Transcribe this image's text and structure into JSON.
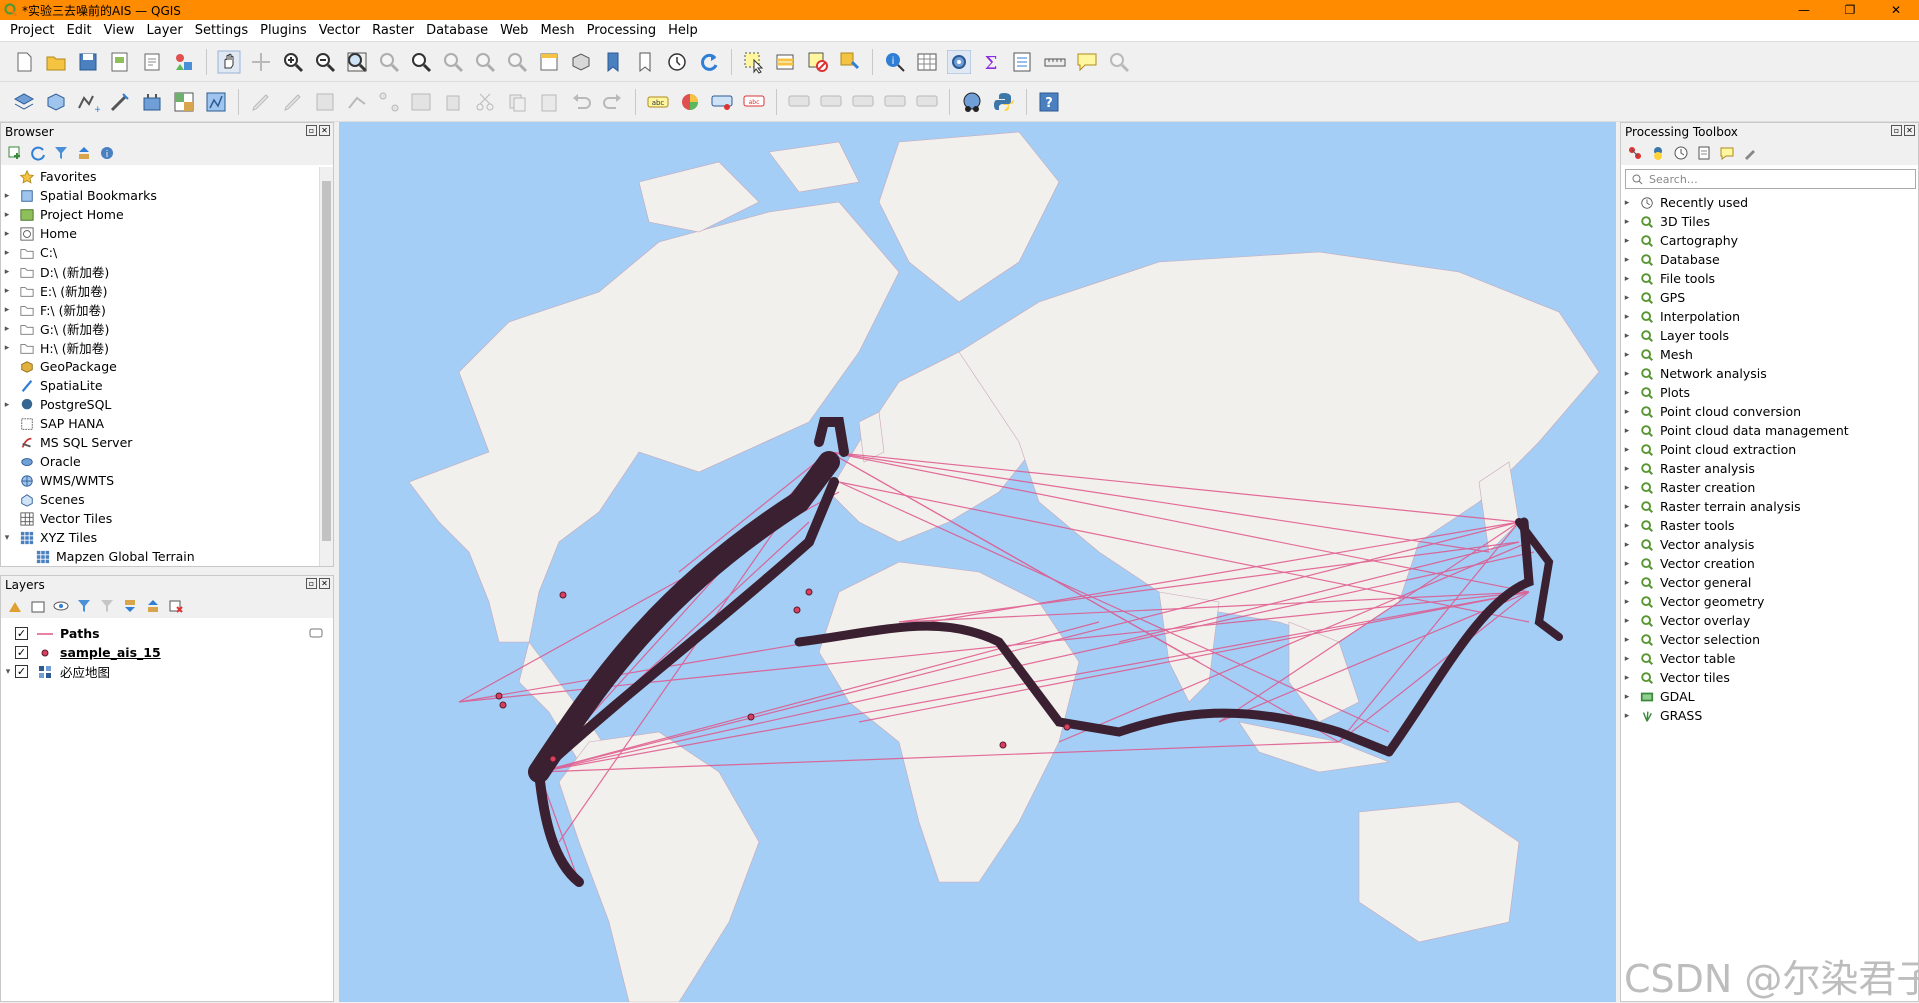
{
  "window": {
    "title": "*实验三去噪前的AIS — QGIS",
    "minimize": "—",
    "maximize": "❐",
    "close": "✕"
  },
  "menu": [
    "Project",
    "Edit",
    "View",
    "Layer",
    "Settings",
    "Plugins",
    "Vector",
    "Raster",
    "Database",
    "Web",
    "Mesh",
    "Processing",
    "Help"
  ],
  "browser": {
    "title": "Browser",
    "items": [
      {
        "label": "Favorites",
        "icon": "star-icon",
        "expandable": false
      },
      {
        "label": "Spatial Bookmarks",
        "icon": "bookmark-icon",
        "expandable": true
      },
      {
        "label": "Project Home",
        "icon": "project-home-icon",
        "expandable": true
      },
      {
        "label": "Home",
        "icon": "home-icon",
        "expandable": true
      },
      {
        "label": "C:\\",
        "icon": "folder-icon",
        "expandable": true
      },
      {
        "label": "D:\\ (新加卷)",
        "icon": "folder-icon",
        "expandable": true
      },
      {
        "label": "E:\\ (新加卷)",
        "icon": "folder-icon",
        "expandable": true
      },
      {
        "label": "F:\\ (新加卷)",
        "icon": "folder-icon",
        "expandable": true
      },
      {
        "label": "G:\\ (新加卷)",
        "icon": "folder-icon",
        "expandable": true
      },
      {
        "label": "H:\\ (新加卷)",
        "icon": "folder-icon",
        "expandable": true
      },
      {
        "label": "GeoPackage",
        "icon": "geopackage-icon",
        "expandable": false
      },
      {
        "label": "SpatiaLite",
        "icon": "spatialite-icon",
        "expandable": false
      },
      {
        "label": "PostgreSQL",
        "icon": "postgresql-icon",
        "expandable": true
      },
      {
        "label": "SAP HANA",
        "icon": "sap-hana-icon",
        "expandable": false
      },
      {
        "label": "MS SQL Server",
        "icon": "mssql-icon",
        "expandable": false
      },
      {
        "label": "Oracle",
        "icon": "oracle-icon",
        "expandable": false
      },
      {
        "label": "WMS/WMTS",
        "icon": "wms-icon",
        "expandable": false
      },
      {
        "label": "Scenes",
        "icon": "scenes-icon",
        "expandable": false
      },
      {
        "label": "Vector Tiles",
        "icon": "vector-tiles-icon",
        "expandable": false
      },
      {
        "label": "XYZ Tiles",
        "icon": "xyz-tiles-icon",
        "expandable": true,
        "expanded": true
      },
      {
        "label": "Mapzen Global Terrain",
        "icon": "xyz-tiles-icon",
        "expandable": false,
        "child": true
      }
    ]
  },
  "layers": {
    "title": "Layers",
    "items": [
      {
        "label": "Paths",
        "checked": true,
        "bold": true,
        "underline": false,
        "symbol": "line"
      },
      {
        "label": "sample_ais_15",
        "checked": true,
        "bold": true,
        "underline": true,
        "symbol": "point"
      },
      {
        "label": "必应地图",
        "checked": true,
        "bold": false,
        "underline": false,
        "symbol": "raster",
        "expandable": true
      }
    ]
  },
  "toolbox": {
    "title": "Processing Toolbox",
    "search_placeholder": "Search…",
    "items": [
      {
        "label": "Recently used",
        "icon": "clock-icon"
      },
      {
        "label": "3D Tiles",
        "icon": "qgis-icon"
      },
      {
        "label": "Cartography",
        "icon": "qgis-icon"
      },
      {
        "label": "Database",
        "icon": "qgis-icon"
      },
      {
        "label": "File tools",
        "icon": "qgis-icon"
      },
      {
        "label": "GPS",
        "icon": "qgis-icon"
      },
      {
        "label": "Interpolation",
        "icon": "qgis-icon"
      },
      {
        "label": "Layer tools",
        "icon": "qgis-icon"
      },
      {
        "label": "Mesh",
        "icon": "qgis-icon"
      },
      {
        "label": "Network analysis",
        "icon": "qgis-icon"
      },
      {
        "label": "Plots",
        "icon": "qgis-icon"
      },
      {
        "label": "Point cloud conversion",
        "icon": "qgis-icon"
      },
      {
        "label": "Point cloud data management",
        "icon": "qgis-icon"
      },
      {
        "label": "Point cloud extraction",
        "icon": "qgis-icon"
      },
      {
        "label": "Raster analysis",
        "icon": "qgis-icon"
      },
      {
        "label": "Raster creation",
        "icon": "qgis-icon"
      },
      {
        "label": "Raster terrain analysis",
        "icon": "qgis-icon"
      },
      {
        "label": "Raster tools",
        "icon": "qgis-icon"
      },
      {
        "label": "Vector analysis",
        "icon": "qgis-icon"
      },
      {
        "label": "Vector creation",
        "icon": "qgis-icon"
      },
      {
        "label": "Vector general",
        "icon": "qgis-icon"
      },
      {
        "label": "Vector geometry",
        "icon": "qgis-icon"
      },
      {
        "label": "Vector overlay",
        "icon": "qgis-icon"
      },
      {
        "label": "Vector selection",
        "icon": "qgis-icon"
      },
      {
        "label": "Vector table",
        "icon": "qgis-icon"
      },
      {
        "label": "Vector tiles",
        "icon": "qgis-icon"
      },
      {
        "label": "GDAL",
        "icon": "gdal-icon"
      },
      {
        "label": "GRASS",
        "icon": "grass-icon"
      }
    ]
  },
  "watermark": "CSDN @尔染君子",
  "colors": {
    "accent": "#ff8c00",
    "water": "#a4cef5",
    "land": "#f2f0ed",
    "path": "#e0558a",
    "track": "#3a2030"
  }
}
